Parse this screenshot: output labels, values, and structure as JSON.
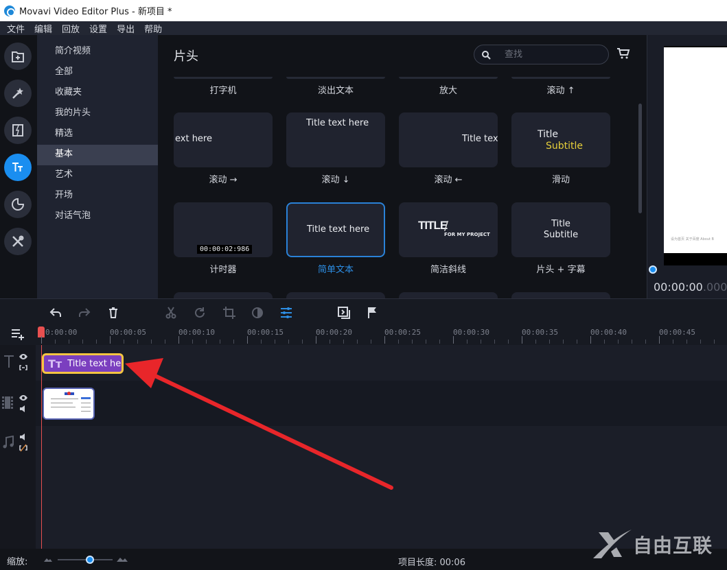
{
  "window": {
    "title": "Movavi Video Editor Plus - 新项目 *"
  },
  "menu": [
    "文件",
    "编辑",
    "回放",
    "设置",
    "导出",
    "帮助"
  ],
  "rail": [
    {
      "name": "import-icon",
      "active": false
    },
    {
      "name": "magic-wand-icon",
      "active": false
    },
    {
      "name": "transitions-icon",
      "active": false
    },
    {
      "name": "titles-icon",
      "active": true
    },
    {
      "name": "stickers-icon",
      "active": false
    },
    {
      "name": "tools-icon",
      "active": false
    }
  ],
  "categories": {
    "items": [
      "简介视频",
      "全部",
      "收藏夹",
      "我的片头",
      "精选",
      "基本",
      "艺术",
      "开场",
      "对话气泡"
    ],
    "active_index": 5
  },
  "gallery": {
    "title": "片头",
    "search_placeholder": "查找",
    "top_row_labels": [
      "打字机",
      "淡出文本",
      "放大",
      "滚动 ↑"
    ],
    "cards": [
      {
        "label": "滚动 →",
        "preview": "ext here"
      },
      {
        "label": "滚动 ↓",
        "preview": "Title text here"
      },
      {
        "label": "滚动 ←",
        "preview": "Title tex"
      },
      {
        "label": "滑动",
        "preview_title": "Title",
        "preview_subtitle": "Subtitle"
      },
      {
        "label": "计时器",
        "timer": "00:00:02:986"
      },
      {
        "label": "简单文本",
        "preview": "Title text here",
        "selected": true
      },
      {
        "label": "简洁斜线",
        "preview_title": "TITLE",
        "preview_subtitle": "FOR MY PROJECT"
      },
      {
        "label": "片头 + 字幕",
        "preview_title": "Title",
        "preview_subtitle": "Subtitle"
      }
    ]
  },
  "preview": {
    "time_main": "00:00:00",
    "time_ms": ".000",
    "footer_text": "设为首页  关于百度  About B"
  },
  "toolbar": {
    "tools": [
      {
        "name": "undo-icon",
        "state": "enabled"
      },
      {
        "name": "redo-icon",
        "state": "disabled"
      },
      {
        "name": "delete-icon",
        "state": "enabled"
      },
      {
        "name": "cut-icon",
        "state": "disabled"
      },
      {
        "name": "rotate-icon",
        "state": "disabled"
      },
      {
        "name": "crop-icon",
        "state": "disabled"
      },
      {
        "name": "color-adjust-icon",
        "state": "disabled"
      },
      {
        "name": "clip-properties-icon",
        "state": "active"
      },
      {
        "name": "insert-icon",
        "state": "enabled"
      },
      {
        "name": "marker-flag-icon",
        "state": "enabled"
      }
    ]
  },
  "ruler": {
    "labels": [
      "00:00:00",
      "00:00:05",
      "00:00:10",
      "00:00:15",
      "00:00:20",
      "00:00:25",
      "00:00:30",
      "00:00:35",
      "00:00:40",
      "00:00:45"
    ]
  },
  "timeline": {
    "title_clip": "Title text here",
    "title_clip_icon": "Tт"
  },
  "bottom": {
    "zoom_label": "缩放:",
    "zoom_level": 0.6,
    "project_length": "项目长度:  00:06"
  },
  "watermark": {
    "text": "自由互联"
  }
}
